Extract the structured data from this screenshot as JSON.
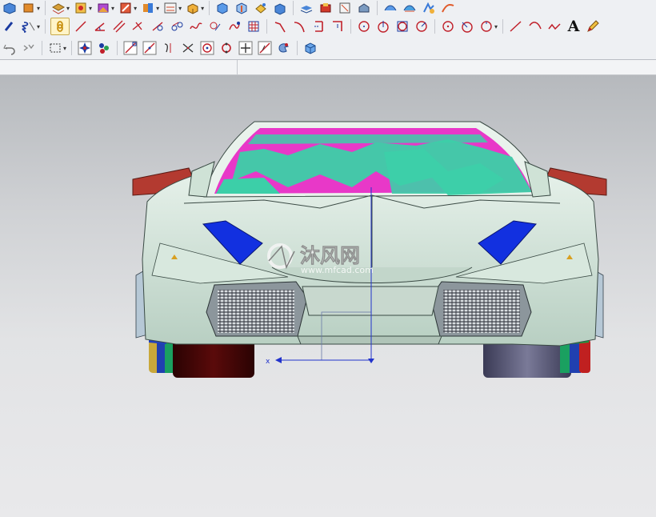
{
  "toolbars": {
    "row1": [
      "render-cube-icon",
      "shaded-box-icon",
      "layer-icon",
      "part-icon",
      "view-icon",
      "view-group-icon",
      "orient-icon",
      "box-icon",
      "cube-icon",
      "cube-icon",
      "feature-icon",
      "block-icon",
      "block-icon",
      "stack-icon",
      "stack-icon",
      "stack-icon",
      "stack-icon",
      "surface-icon",
      "surface-icon",
      "surface-icon"
    ],
    "row2": [
      "point-icon",
      "coil-icon",
      "snap-link-icon",
      "line-icon",
      "angle-line-icon",
      "parallel-line-icon",
      "perpendicular-line-icon",
      "tangent-line-icon",
      "curve-icon",
      "spline-icon",
      "blend-icon",
      "hatch-icon",
      "corner-icon",
      "arc-corner-icon",
      "bracket-corner-icon",
      "offset-corner-icon",
      "circle-center-icon",
      "circle-tangent-icon",
      "circle-square-icon",
      "circle-arc-icon",
      "circle-point-icon",
      "circle-edge-icon",
      "circle-dropdown-icon",
      "diagonal-line-icon",
      "arc-icon",
      "zigzag-icon",
      "text-icon",
      "draw-icon"
    ],
    "row3": [
      "undo-icon",
      "selection-box-icon",
      "snap-points-icon",
      "snap-multi-icon",
      "snap-endpoint-icon",
      "snap-midpoint-icon",
      "snap-tangent-icon",
      "snap-intersection-icon",
      "snap-center-icon",
      "snap-quadrant-icon",
      "snap-grid-icon",
      "snap-on-curve-icon",
      "snap-face-icon",
      "view-cube-icon"
    ],
    "text_tool_label": "A"
  },
  "viewport": {
    "axis_label": "x",
    "watermark": {
      "name": "沐风网",
      "url": "www.mfcad.com"
    }
  },
  "colors": {
    "car_body": "#cfe2d6",
    "windshield_magenta": "#e838c8",
    "windshield_teal": "#3ccfa8",
    "wing_red": "#b33a30",
    "headlight_blue": "#1230e0",
    "axis_blue": "#2233cc",
    "tire_dark_red": "#4a0606",
    "tire_slate": "#5a5a7a"
  }
}
